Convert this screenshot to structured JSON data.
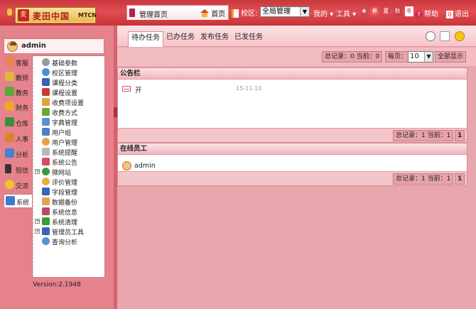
{
  "logo": {
    "cn": "麦田中国",
    "en": "MTCN"
  },
  "header": {
    "tab_home_label": "管理首页",
    "home_link": "首页",
    "campus_label": "校区:",
    "campus_value": "全局管理",
    "menu_my": "我的 ▾",
    "menu_tools": "工具 ▾",
    "skins": [
      {
        "label": "春",
        "color": "#e8505a"
      },
      {
        "label": "夏",
        "color": "#d9434d"
      },
      {
        "label": "秋",
        "color": "#cf3b45"
      },
      {
        "label": "冬",
        "color": "#ffffff"
      }
    ],
    "help": "帮助",
    "logout": "退出"
  },
  "user": {
    "name": "admin"
  },
  "modules": [
    {
      "label": "客服",
      "icon": "customer-service-icon",
      "color": "#e8874b"
    },
    {
      "label": "教师",
      "icon": "teacher-icon",
      "color": "#e7b33a"
    },
    {
      "label": "教务",
      "icon": "academic-icon",
      "color": "#5aa83f"
    },
    {
      "label": "财务",
      "icon": "finance-icon",
      "color": "#f0a52e"
    },
    {
      "label": "仓库",
      "icon": "warehouse-icon",
      "color": "#3d8f3d"
    },
    {
      "label": "人事",
      "icon": "hr-icon",
      "color": "#e1802e"
    },
    {
      "label": "分析",
      "icon": "analysis-icon",
      "color": "#4a7fd0"
    },
    {
      "label": "短信",
      "icon": "sms-icon",
      "color": "#333333"
    },
    {
      "label": "交流",
      "icon": "chat-icon",
      "color": "#f3c233"
    },
    {
      "label": "系统",
      "icon": "system-icon",
      "color": "#3d7bd0"
    }
  ],
  "tree": [
    {
      "label": "基础参数",
      "icon": "gear-icon",
      "color": "#999999",
      "plus": false
    },
    {
      "label": "校区管理",
      "icon": "campus-icon",
      "color": "#4a90d9",
      "plus": false
    },
    {
      "label": "课程分类",
      "icon": "course-category-icon",
      "color": "#3a62b8",
      "plus": false
    },
    {
      "label": "课程设置",
      "icon": "course-settings-icon",
      "color": "#c73a3a",
      "plus": false
    },
    {
      "label": "收费项设置",
      "icon": "fee-item-icon",
      "color": "#e0a63a",
      "plus": false
    },
    {
      "label": "收费方式",
      "icon": "payment-method-icon",
      "color": "#6aa83a",
      "plus": false
    },
    {
      "label": "字典管理",
      "icon": "dictionary-icon",
      "color": "#5a8fd0",
      "plus": false
    },
    {
      "label": "用户组",
      "icon": "user-group-icon",
      "color": "#4a7fc7",
      "plus": false
    },
    {
      "label": "用户管理",
      "icon": "user-management-icon",
      "color": "#e3a24c",
      "plus": false
    },
    {
      "label": "系统提醒",
      "icon": "reminder-icon",
      "color": "#b8b8b8",
      "plus": false
    },
    {
      "label": "系统公告",
      "icon": "announcement-icon",
      "color": "#d94a6a",
      "plus": false
    },
    {
      "label": "微网站",
      "icon": "microsite-icon",
      "color": "#3c9a3c",
      "plus": true
    },
    {
      "label": "评价管理",
      "icon": "evaluation-icon",
      "color": "#e3b23c",
      "plus": false
    },
    {
      "label": "字段管理",
      "icon": "field-management-icon",
      "color": "#3a62b8",
      "plus": false
    },
    {
      "label": "数据备份",
      "icon": "backup-icon",
      "color": "#e3a24c",
      "plus": false
    },
    {
      "label": "系统信息",
      "icon": "system-info-icon",
      "color": "#b84a6a",
      "plus": false
    },
    {
      "label": "系统清理",
      "icon": "cleanup-icon",
      "color": "#3c9a3c",
      "plus": true
    },
    {
      "label": "管理员工具",
      "icon": "admin-tools-icon",
      "color": "#3a62b8",
      "plus": true
    },
    {
      "label": "查询分析",
      "icon": "query-analysis-icon",
      "color": "#5a8fd0",
      "plus": false
    }
  ],
  "version": "Version:2.1948",
  "task_tabs": [
    "待办任务",
    "已办任务",
    "发布任务",
    "已发任务"
  ],
  "task_pager": {
    "summary": "总记录：0 当前：0",
    "per_page_label": "每页：",
    "per_page_value": "10",
    "show_all": "全部显示"
  },
  "notice": {
    "title": "公告栏",
    "items": [
      {
        "title": "开",
        "date": "15-11-10"
      }
    ],
    "summary": "总记录：1 当前：1",
    "page": "1"
  },
  "online": {
    "title": "在线员工",
    "users": [
      {
        "name": "admin"
      }
    ],
    "summary": "总记录：1 当前：1",
    "page": "1"
  }
}
